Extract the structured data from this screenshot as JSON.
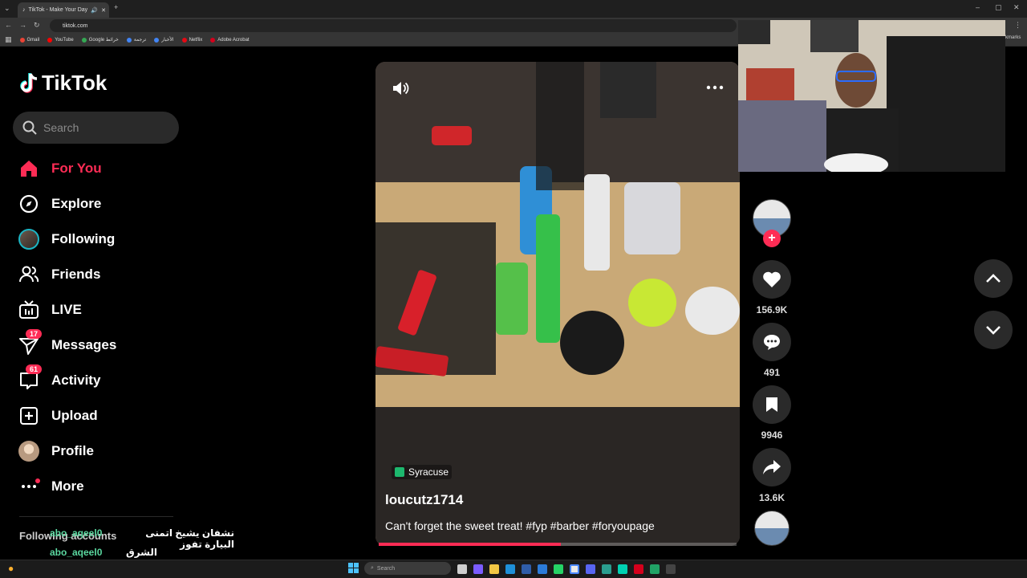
{
  "browser": {
    "tab_title": "TikTok - Make Your Day",
    "url": "tiktok.com",
    "bookmarks": [
      {
        "label": "Gmail",
        "color": "#ea4335"
      },
      {
        "label": "YouTube",
        "color": "#ff0000"
      },
      {
        "label": "Google خرائط",
        "color": "#34a853"
      },
      {
        "label": "ترجمة",
        "color": "#4285f4"
      },
      {
        "label": "الأخبار",
        "color": "#4285f4"
      },
      {
        "label": "Netflix",
        "color": "#e50914"
      },
      {
        "label": "Adobe Acrobat",
        "color": "#d4001c"
      }
    ],
    "bookmarks_partial": "kmarks"
  },
  "sidebar": {
    "logo": "TikTok",
    "search_placeholder": "Search",
    "nav": [
      {
        "label": "For You",
        "icon": "home-icon",
        "active": true
      },
      {
        "label": "Explore",
        "icon": "compass-icon"
      },
      {
        "label": "Following",
        "icon": "following-avatar"
      },
      {
        "label": "Friends",
        "icon": "friends-icon"
      },
      {
        "label": "LIVE",
        "icon": "live-icon"
      },
      {
        "label": "Messages",
        "icon": "messages-icon",
        "badge": "17"
      },
      {
        "label": "Activity",
        "icon": "activity-icon",
        "badge": "61"
      },
      {
        "label": "Upload",
        "icon": "upload-icon"
      },
      {
        "label": "Profile",
        "icon": "profile-avatar"
      },
      {
        "label": "More",
        "icon": "more-icon"
      }
    ],
    "following_accounts": "Following accounts"
  },
  "chat": [
    {
      "user": "abo_aqeel0",
      "message": "نشفان يشيخ اتمنى البيارة تفوز"
    },
    {
      "user": "abo_aqeel0",
      "message": "الشرق زق"
    }
  ],
  "video": {
    "location": "Syracuse",
    "username": "loucutz1714",
    "caption": "Can't forget the sweet treat! #fyp #barber #foryoupage",
    "progress": 0.51
  },
  "actions": {
    "likes": "156.9K",
    "comments": "491",
    "saves": "9946",
    "shares": "13.6K"
  },
  "taskbar": {
    "search_placeholder": "Search"
  },
  "colors": {
    "accent": "#fe2c55",
    "background": "#000000"
  }
}
